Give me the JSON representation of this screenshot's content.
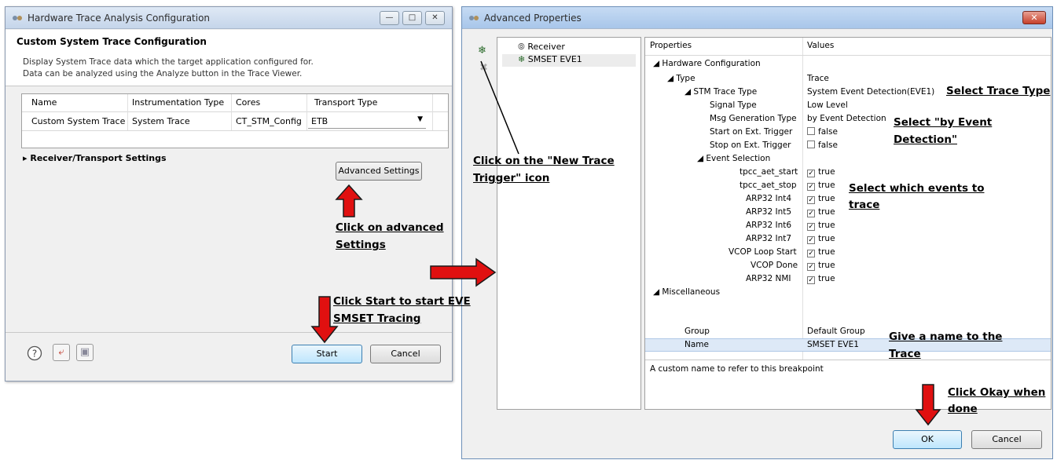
{
  "hw_dialog": {
    "title": "Hardware Trace Analysis Configuration",
    "header_title": "Custom System Trace Configuration",
    "desc_line1": "Display System Trace data which the target application configured for.",
    "desc_line2": "Data can be analyzed using the Analyze button in the Trace Viewer.",
    "columns": [
      "Name",
      "Instrumentation Type",
      "Cores",
      "Transport Type"
    ],
    "row": {
      "name": "Custom System Trace",
      "type": "System Trace",
      "cores": "CT_STM_Config",
      "transport": "ETB"
    },
    "receiver_settings": "Receiver/Transport Settings",
    "advanced_button": "Advanced Settings",
    "start_button": "Start",
    "cancel_button": "Cancel"
  },
  "adv_dialog": {
    "title": "Advanced Properties",
    "tree": [
      "Receiver",
      "SMSET EVE1"
    ],
    "col_properties": "Properties",
    "col_values": "Values",
    "rows": [
      {
        "label": "Hardware Configuration",
        "value": ""
      },
      {
        "label": "Type",
        "value": "Trace"
      },
      {
        "label": "STM Trace Type",
        "value": "System Event Detection(EVE1)"
      },
      {
        "label": "Signal Type",
        "value": "Low Level"
      },
      {
        "label": "Msg Generation Type",
        "value": "by Event Detection"
      },
      {
        "label": "Start on Ext. Trigger",
        "value": "false"
      },
      {
        "label": "Stop on Ext. Trigger",
        "value": "false"
      },
      {
        "label": "Event Selection",
        "value": ""
      },
      {
        "label": "tpcc_aet_start",
        "value": "true"
      },
      {
        "label": "tpcc_aet_stop",
        "value": "true"
      },
      {
        "label": "ARP32 Int4",
        "value": "true"
      },
      {
        "label": "ARP32 Int5",
        "value": "true"
      },
      {
        "label": "ARP32 Int6",
        "value": "true"
      },
      {
        "label": "ARP32 Int7",
        "value": "true"
      },
      {
        "label": "VCOP Loop Start",
        "value": "true"
      },
      {
        "label": "VCOP Done",
        "value": "true"
      },
      {
        "label": "ARP32 NMI",
        "value": "true"
      },
      {
        "label": "Miscellaneous",
        "value": ""
      },
      {
        "label": "Group",
        "value": "Default Group"
      },
      {
        "label": "Name",
        "value": "SMSET EVE1"
      }
    ],
    "description": "A custom name to refer to this breakpoint",
    "ok_button": "OK",
    "cancel_button": "Cancel"
  },
  "annotations": {
    "click_advanced_1": "Click on advanced",
    "click_advanced_2": "Settings",
    "click_start_1": "Click Start to start EVE",
    "click_start_2": "SMSET Tracing",
    "new_trigger_1": "Click on the \"New Trace",
    "new_trigger_2": "Trigger\" icon",
    "select_trace_type": "Select Trace Type",
    "select_event_1": "Select \"by Event",
    "select_event_2": "Detection\"",
    "select_events_1": "Select which events to",
    "select_events_2": "trace",
    "give_name_1": "Give a name to the",
    "give_name_2": "Trace",
    "click_okay_1": "Click Okay when",
    "click_okay_2": "done"
  },
  "colors": {
    "arrow": "#e01010",
    "selection": "#dde9f7"
  }
}
